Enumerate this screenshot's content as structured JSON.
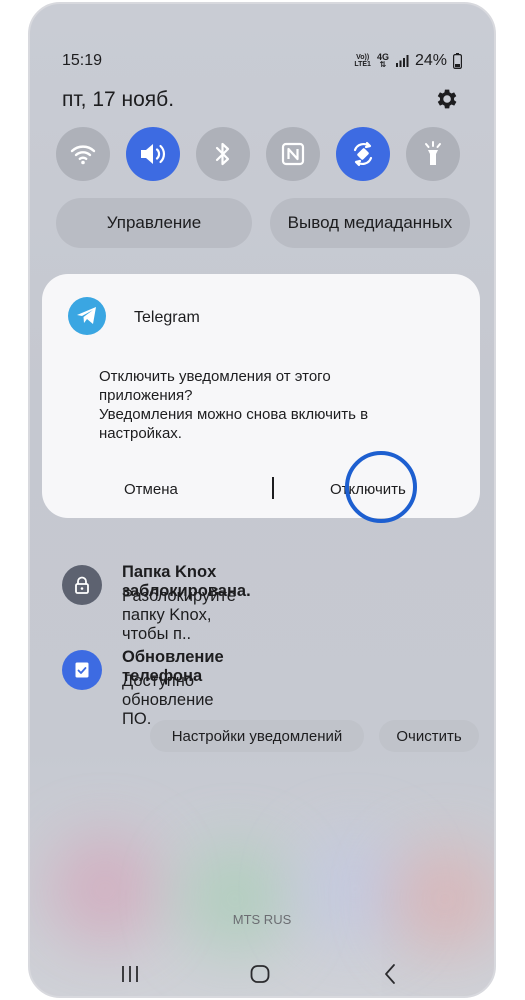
{
  "status_bar": {
    "time": "15:19",
    "volte_top": "Vo))",
    "volte_bottom": "LTE1",
    "network": "4G",
    "battery": "24%"
  },
  "header": {
    "date": "пт, 17 нояб.",
    "settings_icon": "gear-icon"
  },
  "quick_settings": [
    {
      "icon": "wifi-icon",
      "active": false
    },
    {
      "icon": "sound-icon",
      "active": true
    },
    {
      "icon": "bluetooth-icon",
      "active": false
    },
    {
      "icon": "nfc-icon",
      "active": false
    },
    {
      "icon": "auto-rotate-icon",
      "active": true
    },
    {
      "icon": "flashlight-icon",
      "active": false
    }
  ],
  "controls": {
    "device_control": "Управление",
    "media_output": "Вывод медиаданных"
  },
  "dialog": {
    "app_name": "Telegram",
    "message": "Отключить уведомления от этого приложения?",
    "detail": "Уведомления можно снова включить в настройках.",
    "cancel": "Отмена",
    "confirm": "Отключить"
  },
  "notifications": [
    {
      "icon": "lock-icon",
      "title": "Папка Knox заблокирована.",
      "body": "Разблокируйте папку Knox, чтобы п.."
    },
    {
      "icon": "update-icon",
      "title": "Обновление телефона",
      "body": "Доступно обновление ПО."
    }
  ],
  "actions": {
    "notification_settings": "Настройки уведомлений",
    "clear": "Очистить"
  },
  "carrier": "MTS RUS",
  "colors": {
    "accent": "#3d6be2",
    "highlight_ring": "#1d5fd0",
    "telegram": "#3aa6e2"
  }
}
